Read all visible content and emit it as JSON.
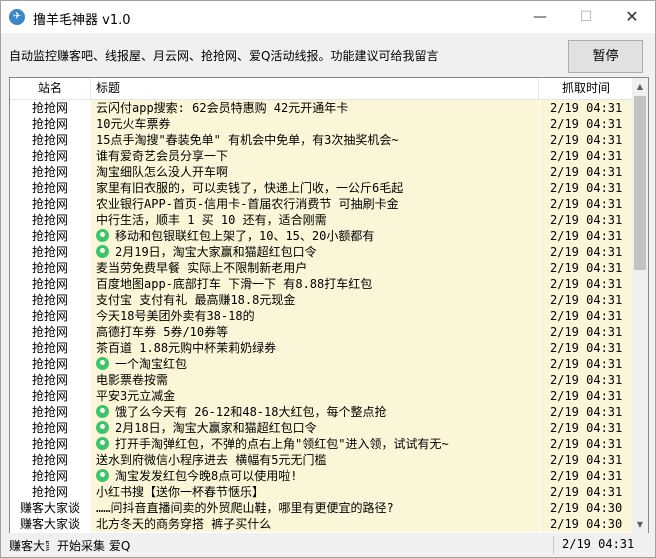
{
  "window": {
    "title": "撸羊毛神器 v1.0",
    "icon": "app-logo-icon"
  },
  "notice": "自动监控赚客吧、线报屋、月云网、抢抢网、爱Q活动线报。功能建议可给我留言",
  "pause_label": "暂停",
  "columns": {
    "site": "站名",
    "title": "标题",
    "time": "抓取时间"
  },
  "rows": [
    {
      "site": "抢抢网",
      "title": "云闪付app搜索: 62会员特惠购 42元开通年卡",
      "time": "2/19 04:31",
      "pin": false
    },
    {
      "site": "抢抢网",
      "title": "10元火车票券",
      "time": "2/19 04:31",
      "pin": false
    },
    {
      "site": "抢抢网",
      "title": "15点手淘搜\"春装免单\" 有机会中免单，有3次抽奖机会~",
      "time": "2/19 04:31",
      "pin": false
    },
    {
      "site": "抢抢网",
      "title": "谁有爱奇艺会员分享一下",
      "time": "2/19 04:31",
      "pin": false
    },
    {
      "site": "抢抢网",
      "title": "淘宝细队怎么没人开车啊",
      "time": "2/19 04:31",
      "pin": false
    },
    {
      "site": "抢抢网",
      "title": "家里有旧衣服的，可以卖钱了，快递上门收，一公斤6毛起",
      "time": "2/19 04:31",
      "pin": false
    },
    {
      "site": "抢抢网",
      "title": "农业银行APP-首页-信用卡-首届农行消费节 可抽刷卡金",
      "time": "2/19 04:31",
      "pin": false
    },
    {
      "site": "抢抢网",
      "title": "中行生活，顺丰 1 买 10 还有，适合刚需",
      "time": "2/19 04:31",
      "pin": false
    },
    {
      "site": "抢抢网",
      "title": "移动和包银联红包上架了，10、15、20小额都有",
      "time": "2/19 04:31",
      "pin": true
    },
    {
      "site": "抢抢网",
      "title": "2月19日，淘宝大家赢和猫超红包口令",
      "time": "2/19 04:31",
      "pin": true
    },
    {
      "site": "抢抢网",
      "title": "麦当劳免费早餐 实际上不限制新老用户",
      "time": "2/19 04:31",
      "pin": false
    },
    {
      "site": "抢抢网",
      "title": "百度地图app-底部打车 下滑一下 有8.88打车红包",
      "time": "2/19 04:31",
      "pin": false
    },
    {
      "site": "抢抢网",
      "title": "支付宝 支付有礼 最高赚18.8元现金",
      "time": "2/19 04:31",
      "pin": false
    },
    {
      "site": "抢抢网",
      "title": "今天18号美团外卖有38-18的",
      "time": "2/19 04:31",
      "pin": false
    },
    {
      "site": "抢抢网",
      "title": "高德打车券 5券/10券等",
      "time": "2/19 04:31",
      "pin": false
    },
    {
      "site": "抢抢网",
      "title": "茶百道 1.88元购中杯茉莉奶绿券",
      "time": "2/19 04:31",
      "pin": false
    },
    {
      "site": "抢抢网",
      "title": "一个淘宝红包",
      "time": "2/19 04:31",
      "pin": true
    },
    {
      "site": "抢抢网",
      "title": "电影票卷按需",
      "time": "2/19 04:31",
      "pin": false
    },
    {
      "site": "抢抢网",
      "title": "平安3元立减金",
      "time": "2/19 04:31",
      "pin": false
    },
    {
      "site": "抢抢网",
      "title": "饿了么今天有 26-12和48-18大红包，每个整点抢",
      "time": "2/19 04:31",
      "pin": true
    },
    {
      "site": "抢抢网",
      "title": "2月18日，淘宝大赢家和猫超红包口令",
      "time": "2/19 04:31",
      "pin": true
    },
    {
      "site": "抢抢网",
      "title": "打开手淘弹红包，不弹的点右上角\"领红包\"进入领，试试有无~",
      "time": "2/19 04:31",
      "pin": true
    },
    {
      "site": "抢抢网",
      "title": "送水到府微信小程序进去 横幅有5元无门槛",
      "time": "2/19 04:31",
      "pin": false
    },
    {
      "site": "抢抢网",
      "title": "淘宝发发红包今晚8点可以使用啦!",
      "time": "2/19 04:31",
      "pin": true
    },
    {
      "site": "抢抢网",
      "title": "小红书搜【送你一杯春节惬乐】",
      "time": "2/19 04:31",
      "pin": false
    },
    {
      "site": "赚客大家谈",
      "title": "……问抖音直播间卖的外贸爬山鞋，哪里有更便宜的路径?",
      "time": "2/19 04:30",
      "pin": false
    },
    {
      "site": "赚客大家谈",
      "title": "北方冬天的商务穿搭 裤子买什么",
      "time": "2/19 04:30",
      "pin": false
    }
  ],
  "status": {
    "site": "赚客大家谈",
    "message": "开始采集 爱Q",
    "time": "2/19 04:31"
  }
}
